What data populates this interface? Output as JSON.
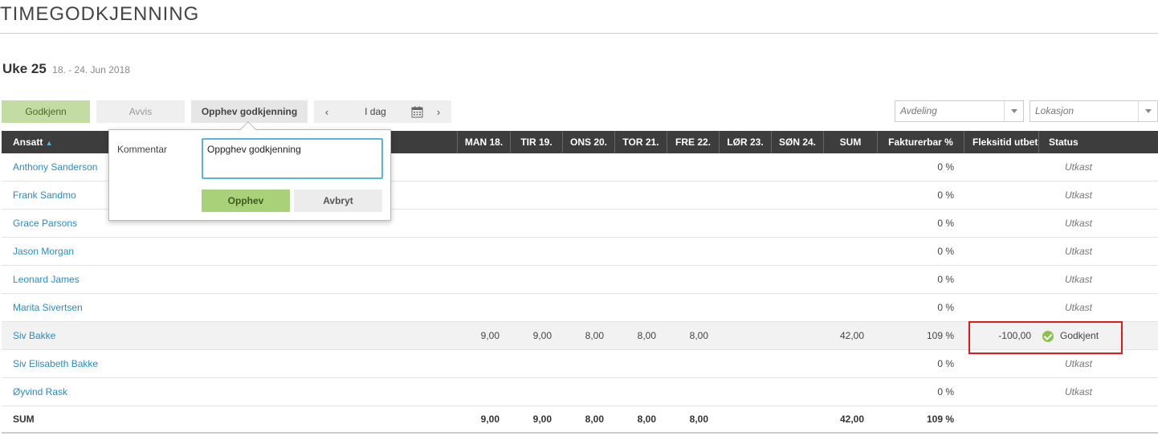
{
  "page": {
    "title": "TIMEGODKJENNING"
  },
  "week": {
    "label": "Uke 25",
    "range": "18. - 24. Jun 2018"
  },
  "toolbar": {
    "approve": "Godkjenn",
    "reject": "Avvis",
    "unapprove": "Opphev godkjenning",
    "prev": "‹",
    "today": "I dag",
    "next": "›",
    "department_placeholder": "Avdeling",
    "location_placeholder": "Lokasjon"
  },
  "table": {
    "headers": {
      "employee": "Ansatt",
      "sort_indicator": "▲",
      "mon": "MAN 18.",
      "tue": "TIR 19.",
      "wed": "ONS 20.",
      "thu": "TOR 21.",
      "fri": "FRE 22.",
      "sat": "LØR 23.",
      "sun": "SØN 24.",
      "sum": "SUM",
      "billable": "Fakturerbar %",
      "flex": "Fleksitid utbet",
      "status": "Status"
    },
    "rows": [
      {
        "name": "Anthony Sanderson",
        "mon": "",
        "tue": "",
        "wed": "",
        "thu": "",
        "fri": "",
        "sat": "",
        "sun": "",
        "sum": "",
        "billable": "0 %",
        "flex": "",
        "status": "Utkast"
      },
      {
        "name": "Frank Sandmo",
        "mon": "",
        "tue": "",
        "wed": "",
        "thu": "",
        "fri": "",
        "sat": "",
        "sun": "",
        "sum": "",
        "billable": "0 %",
        "flex": "",
        "status": "Utkast"
      },
      {
        "name": "Grace Parsons",
        "mon": "",
        "tue": "",
        "wed": "",
        "thu": "",
        "fri": "",
        "sat": "",
        "sun": "",
        "sum": "",
        "billable": "0 %",
        "flex": "",
        "status": "Utkast"
      },
      {
        "name": "Jason Morgan",
        "mon": "",
        "tue": "",
        "wed": "",
        "thu": "",
        "fri": "",
        "sat": "",
        "sun": "",
        "sum": "",
        "billable": "0 %",
        "flex": "",
        "status": "Utkast"
      },
      {
        "name": "Leonard James",
        "mon": "",
        "tue": "",
        "wed": "",
        "thu": "",
        "fri": "",
        "sat": "",
        "sun": "",
        "sum": "",
        "billable": "0 %",
        "flex": "",
        "status": "Utkast"
      },
      {
        "name": "Marita Sivertsen",
        "mon": "",
        "tue": "",
        "wed": "",
        "thu": "",
        "fri": "",
        "sat": "",
        "sun": "",
        "sum": "",
        "billable": "0 %",
        "flex": "",
        "status": "Utkast"
      },
      {
        "name": "Siv Bakke",
        "mon": "9,00",
        "tue": "9,00",
        "wed": "8,00",
        "thu": "8,00",
        "fri": "8,00",
        "sat": "",
        "sun": "",
        "sum": "42,00",
        "billable": "109 %",
        "flex": "-100,00",
        "status": "Godkjent"
      },
      {
        "name": "Siv Elisabeth Bakke",
        "mon": "",
        "tue": "",
        "wed": "",
        "thu": "",
        "fri": "",
        "sat": "",
        "sun": "",
        "sum": "",
        "billable": "0 %",
        "flex": "",
        "status": "Utkast"
      },
      {
        "name": "Øyvind Rask",
        "mon": "",
        "tue": "",
        "wed": "",
        "thu": "",
        "fri": "",
        "sat": "",
        "sun": "",
        "sum": "",
        "billable": "0 %",
        "flex": "",
        "status": "Utkast"
      }
    ],
    "sum_row": {
      "label": "SUM",
      "mon": "9,00",
      "tue": "9,00",
      "wed": "8,00",
      "thu": "8,00",
      "fri": "8,00",
      "sum": "42,00",
      "billable": "109 %"
    }
  },
  "popover": {
    "label": "Kommentar",
    "comment_value": "Oppghev godkjenning",
    "confirm": "Opphev",
    "cancel": "Avbryt"
  },
  "colors": {
    "link": "#2a8bc2",
    "approve_button": "#c3dca3",
    "header_bg": "#3d3d3d",
    "highlight_border": "#e0191c",
    "approved_check": "#8cc152"
  }
}
